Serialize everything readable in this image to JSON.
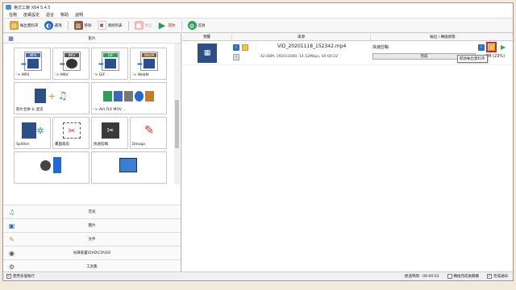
{
  "window": {
    "title": "格式工廠 X64 5.4.5"
  },
  "menu": [
    "任務",
    "皮膚設定",
    "語言",
    "幫助",
    "說明"
  ],
  "toolbar": {
    "output_folder": "輸出資料夾",
    "options": "選項",
    "remove": "移除",
    "clear_list": "清除列表",
    "stop": "停止",
    "start": "開始",
    "homepage": "首頁"
  },
  "left": {
    "video_header": "影片",
    "tiles": [
      {
        "tag": "MP4",
        "tag_color": "#3b66c4",
        "caption": "-> MP4"
      },
      {
        "tag": "MKV",
        "tag_color": "#555555",
        "caption": "-> MKV"
      },
      {
        "tag": "GIF",
        "tag_color": "#2f9e5b",
        "caption": "-> GIF"
      },
      {
        "tag": "WebM",
        "tag_color": "#8a5a2c",
        "caption": "-> WebM"
      },
      {
        "caption": "影片合併 & 混流"
      },
      {
        "caption": "-> AVI FLV MOV ..."
      },
      {
        "caption": "Splitter"
      },
      {
        "caption": "畫面裁剪"
      },
      {
        "caption": "快速剪輯"
      },
      {
        "caption": "Delogo"
      }
    ],
    "categories": [
      {
        "icon": "♫",
        "label": "音訊"
      },
      {
        "icon": "▣",
        "label": "圖片"
      },
      {
        "icon": "✎",
        "label": "文件"
      },
      {
        "icon": "◉",
        "label": "光碟裝置\\DVD\\CD\\ISO"
      },
      {
        "icon": "⚙",
        "label": "工具集"
      }
    ]
  },
  "table": {
    "headers": [
      "預覽",
      "來源",
      "輸出 / 轉換狀態"
    ],
    "rows": [
      {
        "file": "VID_20201118_152342.mp4",
        "info": "42.68M, 1920x1080, 14.52Mbps, 00:00:22",
        "mode": "快速剪輯",
        "status": "完成",
        "progress_pct": 100,
        "size_percent": "3M (23%)"
      }
    ],
    "tooltip": "開啟輸出資料夾"
  },
  "statusbar": {
    "show_notify": "使用多個執行",
    "elapsed": "經過時間 : 00:00:03",
    "shutdown": "轉換完成後關機",
    "notify": "完成通知"
  }
}
